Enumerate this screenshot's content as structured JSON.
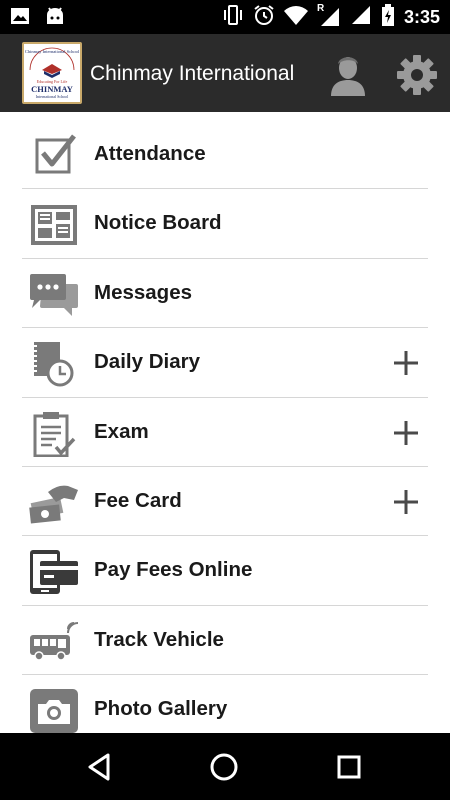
{
  "status_bar": {
    "time": "3:35",
    "icons": [
      "image-icon",
      "android-icon",
      "vibrate-icon",
      "alarm-icon",
      "wifi-icon",
      "roaming-signal-icon",
      "signal-icon",
      "battery-charging-icon"
    ],
    "roaming_indicator": "R"
  },
  "app_bar": {
    "title": "Chinmay International",
    "logo": {
      "arc_text": "Chinmay International School",
      "motto": "Educating For Life",
      "name": "CHINMAY",
      "sub": "International School"
    }
  },
  "menu": {
    "items": [
      {
        "label": "Attendance",
        "icon": "checkbox-icon",
        "expandable": false
      },
      {
        "label": "Notice Board",
        "icon": "notice-board-icon",
        "expandable": false
      },
      {
        "label": "Messages",
        "icon": "chat-bubbles-icon",
        "expandable": false
      },
      {
        "label": "Daily Diary",
        "icon": "diary-clock-icon",
        "expandable": true
      },
      {
        "label": "Exam",
        "icon": "clipboard-check-icon",
        "expandable": true
      },
      {
        "label": "Fee Card",
        "icon": "cash-hand-icon",
        "expandable": true
      },
      {
        "label": "Pay Fees Online",
        "icon": "phone-card-icon",
        "expandable": false
      },
      {
        "label": "Track Vehicle",
        "icon": "bus-signal-icon",
        "expandable": false
      },
      {
        "label": "Photo Gallery",
        "icon": "camera-icon",
        "expandable": false
      }
    ]
  },
  "colors": {
    "app_bar": "#2b2b2b",
    "icon_gray": "#7a7a7a",
    "divider": "#d6d6d6",
    "text": "#1a1a1a",
    "logo_red": "#b0302a",
    "logo_navy": "#1f2f6b"
  }
}
